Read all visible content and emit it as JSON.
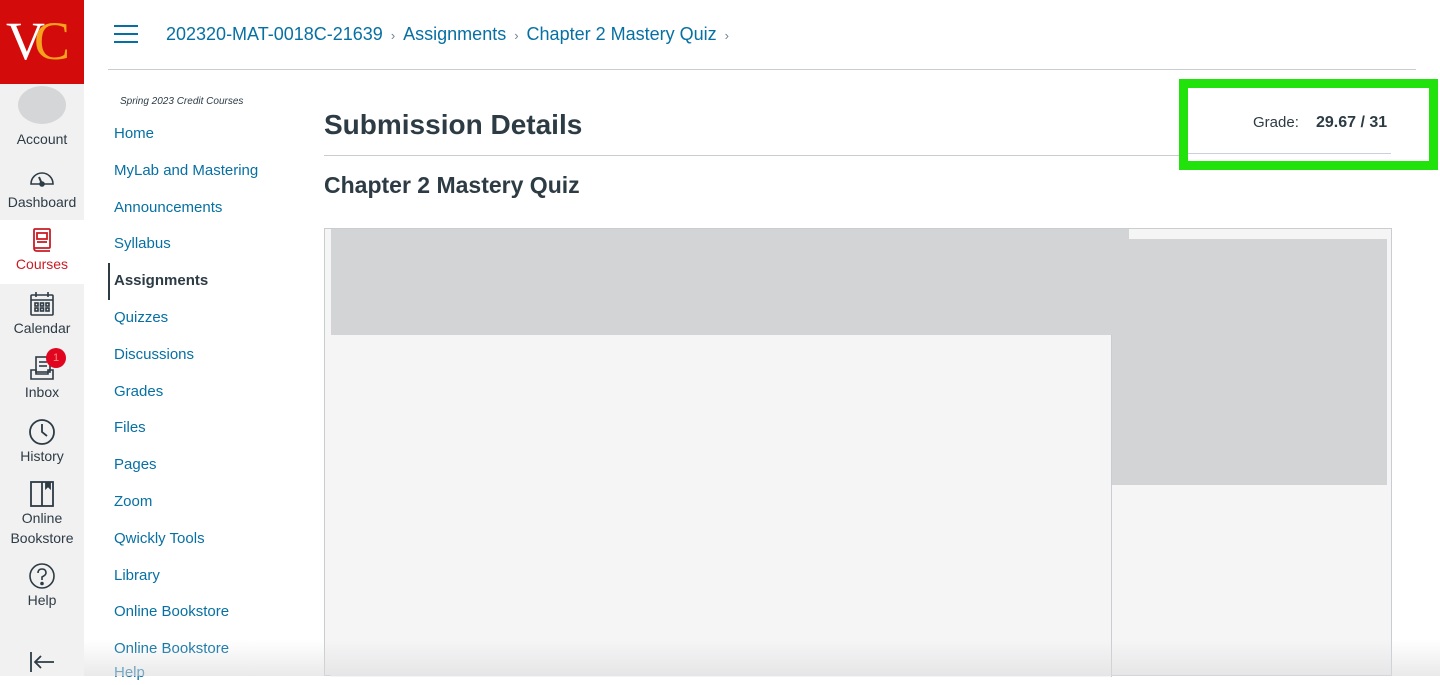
{
  "global_nav": {
    "logo": {
      "letters": [
        "V",
        "C"
      ],
      "bg_color": "#d40b0b",
      "accent_color": "#f6a21c"
    },
    "items": [
      {
        "label": "Account",
        "icon": "avatar"
      },
      {
        "label": "Dashboard",
        "icon": "speedometer-icon"
      },
      {
        "label": "Courses",
        "icon": "book-icon",
        "active": true
      },
      {
        "label": "Calendar",
        "icon": "calendar-icon"
      },
      {
        "label": "Inbox",
        "icon": "inbox-icon",
        "badge": "1"
      },
      {
        "label": "History",
        "icon": "clock-icon"
      },
      {
        "label": "Online",
        "label2": "Bookstore",
        "icon": "bookstore-icon"
      },
      {
        "label": "Help",
        "icon": "help-icon"
      }
    ],
    "collapse_icon": "collapse-arrow-icon",
    "active_color": "#c81d25"
  },
  "header": {
    "breadcrumb": [
      {
        "label": "202320-MAT-0018C-21639"
      },
      {
        "label": "Assignments"
      },
      {
        "label": "Chapter 2 Mastery Quiz"
      }
    ],
    "separator": "›",
    "link_color": "#0770a3"
  },
  "course_nav": {
    "subtitle": "Spring 2023 Credit Courses",
    "items": [
      {
        "label": "Home"
      },
      {
        "label": "MyLab and Mastering"
      },
      {
        "label": "Announcements"
      },
      {
        "label": "Syllabus"
      },
      {
        "label": "Assignments",
        "active": true
      },
      {
        "label": "Quizzes"
      },
      {
        "label": "Discussions"
      },
      {
        "label": "Grades"
      },
      {
        "label": "Files"
      },
      {
        "label": "Pages"
      },
      {
        "label": "Zoom"
      },
      {
        "label": "Qwickly Tools"
      },
      {
        "label": "Library"
      },
      {
        "label": "Online Bookstore"
      },
      {
        "label": "Online Bookstore Help"
      }
    ]
  },
  "main": {
    "page_title": "Submission Details",
    "assignment_title": "Chapter 2 Mastery Quiz",
    "grade": {
      "label": "Grade:",
      "value": "29.67 / 31",
      "highlight_color": "#22e20c"
    }
  }
}
